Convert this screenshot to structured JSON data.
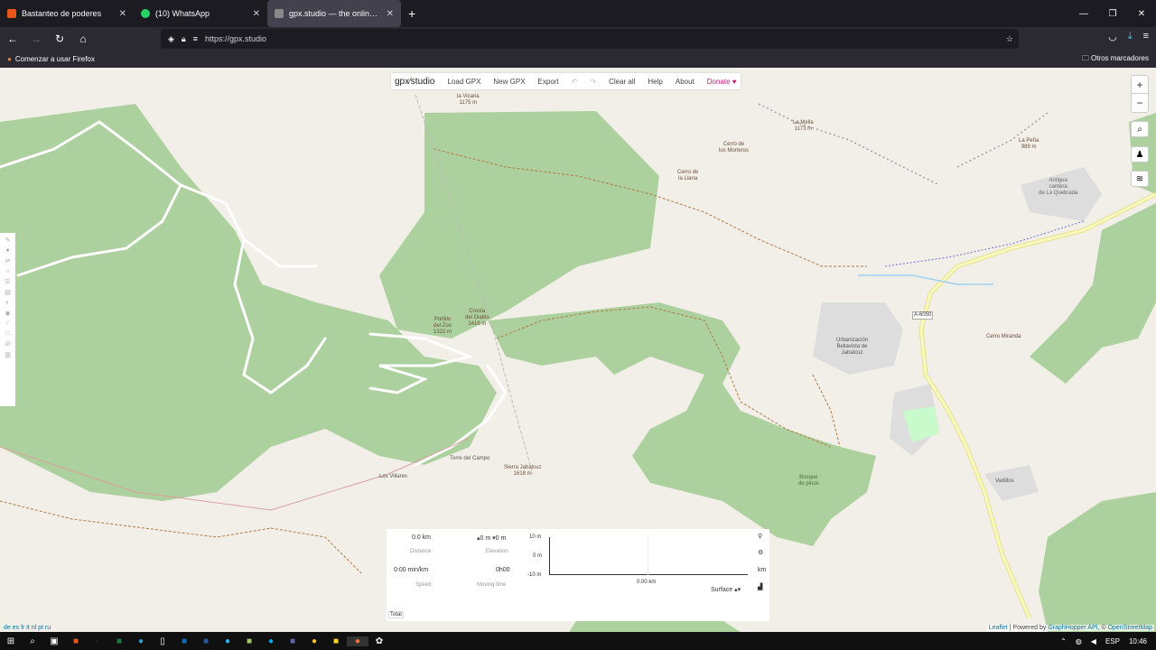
{
  "tabs": [
    {
      "label": "Bastanteo de poderes",
      "color": "#e8581c"
    },
    {
      "label": "(10) WhatsApp",
      "color": "#25d366"
    },
    {
      "label": "gpx.studio — the online GPX file",
      "color": "#888888"
    }
  ],
  "url": "https://gpx.studio",
  "bookmarks": {
    "left": "Comenzar a usar Firefox",
    "right": "Otros marcadores"
  },
  "menu": {
    "logo": "gpx⁄studio",
    "load": "Load GPX",
    "new": "New GPX",
    "export": "Export",
    "clear": "Clear all",
    "help": "Help",
    "about": "About",
    "donate": "Donate ♥"
  },
  "map_labels": [
    {
      "text": "la Vicaria\n1175 m"
    },
    {
      "text": "Cerro de\nlos Morteros"
    },
    {
      "text": "Cerro de\nla Llana"
    },
    {
      "text": "La Mella\n1173 m"
    },
    {
      "text": "La Peña\n989 m"
    },
    {
      "text": "Antigua\ncantera\nde La Quebrada"
    },
    {
      "text": "A-6050"
    },
    {
      "text": "Urbanización\nBellavista de\nJabalcuz"
    },
    {
      "text": "Cerro Miranda"
    },
    {
      "text": "Cresta\ndel Diablo\n1416 m"
    },
    {
      "text": "Portillo\ndel Zoo\n1322 m"
    },
    {
      "text": "Torre del Campo"
    },
    {
      "text": "Sierra Jabalcuz\n1618 m"
    },
    {
      "text": "Los Villares"
    },
    {
      "text": "Bosque\nde pinos"
    },
    {
      "text": "Vadillos"
    }
  ],
  "elevation": {
    "distance": "0.0 km",
    "distance_label": "Distance",
    "elevation": "▴0 m ▾0 m",
    "elevation_label": "Elevation",
    "speed": "0:00 min/km",
    "speed_label": "Speed",
    "moving": "0h00",
    "moving_label": "Moving time",
    "y_ticks": [
      "10 m",
      "0 m",
      "-10 m"
    ],
    "x_tick": "0.00 km",
    "unit": "km",
    "surface": "Surface ▴▾",
    "total": "Total"
  },
  "attribution": {
    "leaflet": "Leaflet",
    "mid": " | Powered by ",
    "gh": "GraphHopper API",
    "comma": ", © ",
    "osm": "OpenStreetMap"
  },
  "langs": "de es fr it nl pt ru",
  "tray": {
    "lang": "ESP",
    "time": "10:46"
  }
}
